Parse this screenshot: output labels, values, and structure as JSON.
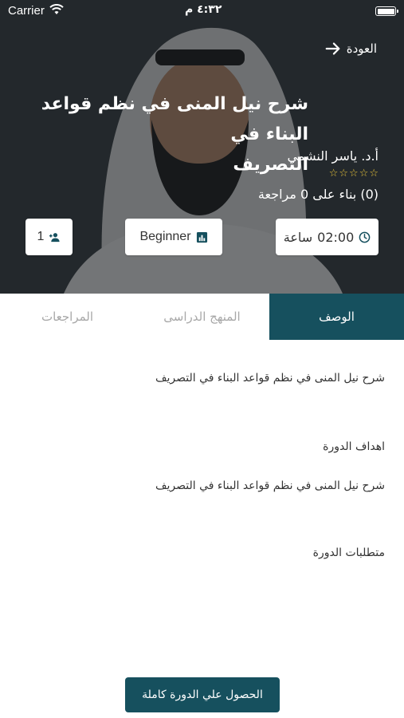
{
  "status_bar": {
    "carrier": "Carrier",
    "time": "٤:٣٢ م"
  },
  "header": {
    "back_label": "العودة",
    "title_line1": "شرح نيل المنى في نظم قواعد البناء في",
    "title_line2": "التصريف",
    "instructor": "أ.د. ياسر النشمي",
    "rating_stars": 0,
    "rating_max": 5,
    "review_text": "(0) بناء على 0 مراجعة",
    "duration_value": "02:00",
    "duration_unit": "ساعة",
    "level": "Beginner",
    "students": "1"
  },
  "tabs": [
    {
      "label": "الوصف",
      "active": true
    },
    {
      "label": "المنهج الدراسى",
      "active": false
    },
    {
      "label": "المراجعات",
      "active": false
    }
  ],
  "description": {
    "summary": "شرح نيل المنى في نظم قواعد البناء في التصريف",
    "objectives_heading": "اهداف الدورة",
    "objectives_text": "شرح نيل المنى في نظم قواعد البناء في التصريف",
    "requirements_heading": "متطلبات الدورة"
  },
  "cta_label": "الحصول علي الدورة كاملة",
  "colors": {
    "primary": "#16505e",
    "star": "#e7c33a"
  }
}
